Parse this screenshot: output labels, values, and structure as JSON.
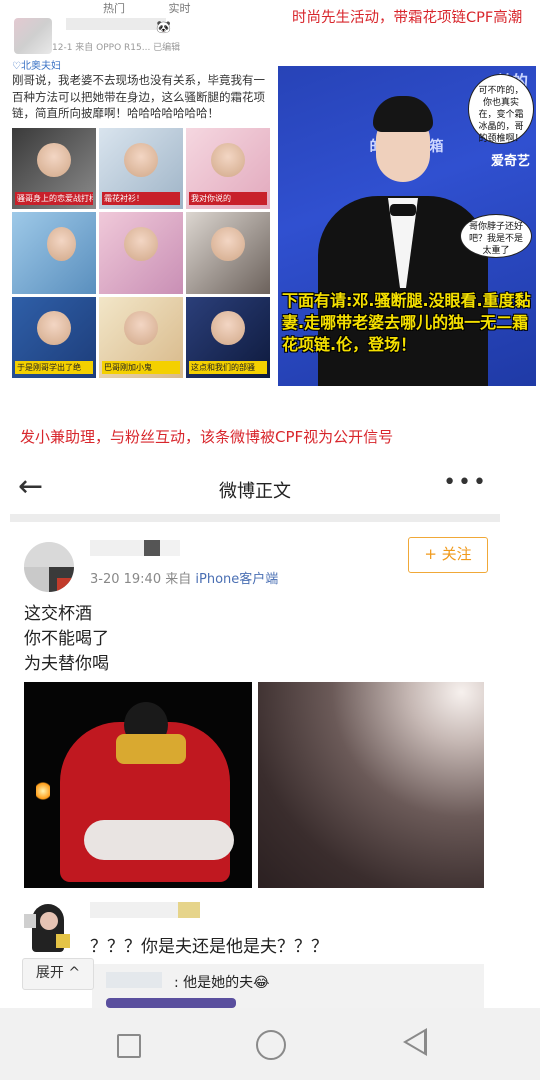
{
  "notes": {
    "top_right": "时尚先生活动，带霜花项链CPF高潮",
    "middle": "发小兼助理，与粉丝互动，该条微博被CPF视为公开信号"
  },
  "top_post": {
    "tabs": [
      "热门",
      "实时"
    ],
    "meta": "12-1  来自 OPPO R15...  已编辑",
    "tag": "♡北奥夫妇",
    "text": "刚哥说，我老婆不去现场也没有关系，毕竟我有一百种方法可以把她带在身边，这么骚断腿的霜花项链，简直所向披靡啊！哈哈哈哈哈哈哈！",
    "grid_captions": [
      "骚哥身上的恋爱战打样",
      "霜花衬衫！",
      "我对你说的",
      "",
      "",
      "",
      "于是刚哥学出了绝",
      "巴哥刚加小鬼",
      "这点和我们的部骚"
    ]
  },
  "right_photo": {
    "logo_top": "美的",
    "stage_text": "的微晶冰箱",
    "iqiyi": "爱奇艺",
    "bubble1": "可不咋的，你也真实在，变个霜冰晶的，哥的颈椎啊！",
    "bubble2": "哥你脖子还好吧？我是不是太重了",
    "caption": "下面有请:邓.骚断腿.没眼看.重度黏妻.走哪带老婆去哪儿的独一无二霜花项链.伦，登场！"
  },
  "weibo": {
    "nav_title": "微博正文",
    "more": "•••",
    "time": "3-20 19:40",
    "source_prefix": "来自",
    "source": "iPhone客户端",
    "follow": "+ 关注",
    "lines": [
      "这交杯酒",
      "你不能喝了",
      "为夫替你喝"
    ],
    "comment": "？？？你是夫还是他是夫？？？",
    "reply": ": 他是她的夫😂",
    "expand": "展开 ^"
  }
}
